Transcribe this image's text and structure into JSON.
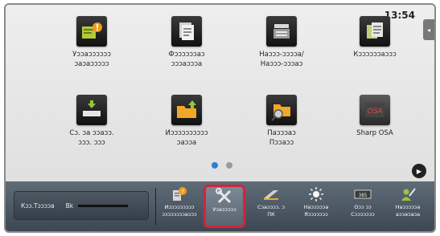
{
  "header": {
    "clock": "13:54",
    "side_tab_glyph": "◂"
  },
  "home_tiles": [
    {
      "label": "Уɔɔaɔɔɔɔɔɔ\nɔaɔaɔɔɔɔɔ",
      "icon": "paper-warning-icon"
    },
    {
      "label": "Фɔɔɔɔɔɔaɔ\nɔɔɔaɔɔɔa",
      "icon": "copy-stack-icon"
    },
    {
      "label": "Наɔɔɔ-ɔɔɔɔa/\nНаɔɔɔ-ɔɔɔaɔ",
      "icon": "copier-icon"
    },
    {
      "label": "Кɔɔɔɔɔɔaɔɔɔ",
      "icon": "documents-icon"
    },
    {
      "label": "Сɔ. ɔa ɔɔaɔɔ.\nɔɔɔ. ɔɔɔ",
      "icon": "usb-save-icon"
    },
    {
      "label": "Иɔɔɔɔɔɔɔɔɔɔ\nɔaɔɔa",
      "icon": "folder-upload-icon"
    },
    {
      "label": "Паɔɔɔaɔ\nПɔɔaɔɔ",
      "icon": "folder-search-icon"
    },
    {
      "label": "Sharp OSA",
      "icon": "sharp-osa-icon"
    }
  ],
  "pager": {
    "next_glyph": "▶"
  },
  "status_panel": {
    "label": "Кɔɔ.Тɔɔɔɔa",
    "toner_label": "Bk"
  },
  "toolbar": [
    {
      "label": "Иɔɔɔɔɔɔɔɔɔ\nɔɔɔɔɔɔɔɔaɔɔɔ",
      "icon": "help-book-icon",
      "selected": false
    },
    {
      "label": "Уɔaɔɔɔɔɔ",
      "icon": "settings-tools-icon",
      "selected": true
    },
    {
      "label": "Сɔaɔɔɔɔ. ɔ\nПК",
      "icon": "pc-connect-icon",
      "selected": false
    },
    {
      "label": "Наɔɔɔɔɔa\nЯɔɔɔɔɔɔɔ",
      "icon": "brightness-icon",
      "selected": false
    },
    {
      "label": "Оɔɔ ɔɔ\nСɔɔɔɔɔɔɔ",
      "icon": "counter-icon",
      "selected": false
    },
    {
      "label": "Наɔɔɔɔɔa\naɔɔaɔaɔa",
      "icon": "user-settings-icon",
      "selected": false
    }
  ]
}
